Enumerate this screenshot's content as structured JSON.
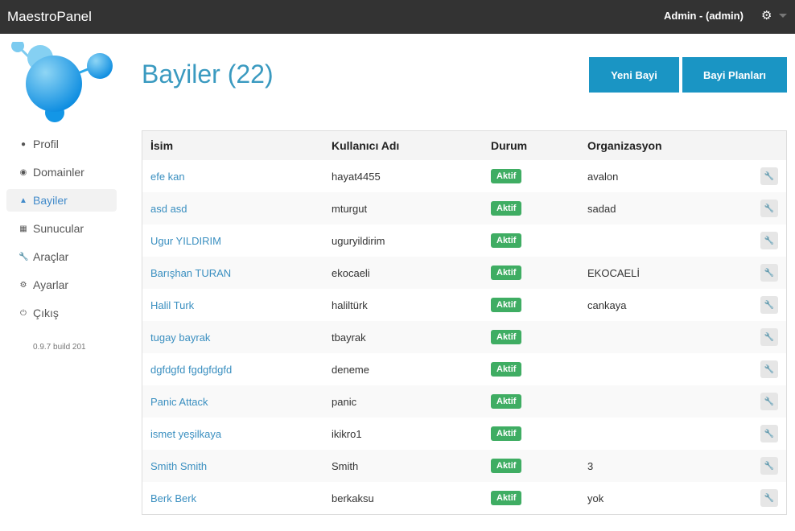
{
  "app": {
    "brand": "MaestroPanel",
    "user": "Admin - (admin)"
  },
  "sidebar": {
    "items": [
      {
        "label": "Profil",
        "icon": "user-icon"
      },
      {
        "label": "Domainler",
        "icon": "globe-icon"
      },
      {
        "label": "Bayiler",
        "icon": "sitemap-icon",
        "active": true
      },
      {
        "label": "Sunucular",
        "icon": "server-icon"
      },
      {
        "label": "Araçlar",
        "icon": "wrench-icon"
      },
      {
        "label": "Ayarlar",
        "icon": "gear-icon"
      },
      {
        "label": "Çıkış",
        "icon": "power-icon"
      }
    ],
    "version": "0.9.7 build 201"
  },
  "main": {
    "title": "Bayiler (22)",
    "buttons": {
      "new": "Yeni Bayi",
      "plans": "Bayi Planları"
    },
    "columns": [
      "İsim",
      "Kullanıcı Adı",
      "Durum",
      "Organizasyon"
    ],
    "rows": [
      {
        "name": "efe kan",
        "user": "hayat4455",
        "status": "Aktif",
        "org": "avalon"
      },
      {
        "name": "asd asd",
        "user": "mturgut",
        "status": "Aktif",
        "org": "sadad"
      },
      {
        "name": "Ugur YILDIRIM",
        "user": "uguryildirim",
        "status": "Aktif",
        "org": ""
      },
      {
        "name": "Barışhan TURAN",
        "user": "ekocaeli",
        "status": "Aktif",
        "org": "EKOCAELİ"
      },
      {
        "name": "Halil Turk",
        "user": "haliltürk",
        "status": "Aktif",
        "org": "cankaya"
      },
      {
        "name": "tugay bayrak",
        "user": "tbayrak",
        "status": "Aktif",
        "org": ""
      },
      {
        "name": "dgfdgfd fgdgfdgfd",
        "user": "deneme",
        "status": "Aktif",
        "org": ""
      },
      {
        "name": "Panic Attack",
        "user": "panic",
        "status": "Aktif",
        "org": ""
      },
      {
        "name": "ismet yeşilkaya",
        "user": "ikikro1",
        "status": "Aktif",
        "org": ""
      },
      {
        "name": "Smith Smith",
        "user": "Smith",
        "status": "Aktif",
        "org": "3"
      },
      {
        "name": "Berk Berk",
        "user": "berkaksu",
        "status": "Aktif",
        "org": "yok"
      }
    ]
  },
  "colors": {
    "accent": "#1a95c4",
    "status": "#3fad63",
    "topbar": "#333333"
  }
}
